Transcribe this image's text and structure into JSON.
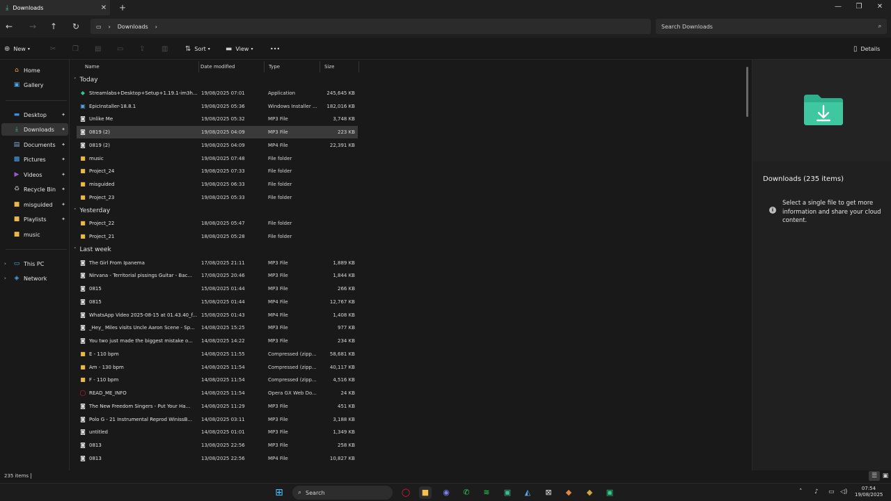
{
  "window": {
    "tab_title": "Downloads",
    "new_tab": "+",
    "close_tab": "✕"
  },
  "address": {
    "breadcrumb": [
      "Downloads"
    ],
    "search_placeholder": "Search Downloads"
  },
  "commands": {
    "new": "New",
    "sort": "Sort",
    "view": "View",
    "more": "•••",
    "details": "Details"
  },
  "sidebar": {
    "items": [
      {
        "label": "Home",
        "icon": "home-icon",
        "glyph": "⌂",
        "color": "#e6a23c",
        "pinned": false
      },
      {
        "label": "Gallery",
        "icon": "gallery-icon",
        "glyph": "▣",
        "color": "#4fa3e0",
        "pinned": false
      },
      {
        "label": "Desktop",
        "icon": "desktop-icon",
        "glyph": "▬",
        "color": "#3d8ee0",
        "pinned": true
      },
      {
        "label": "Downloads",
        "icon": "download-icon",
        "glyph": "⤓",
        "color": "#3fb8a4",
        "pinned": true,
        "selected": true
      },
      {
        "label": "Documents",
        "icon": "document-icon",
        "glyph": "▤",
        "color": "#7fa7d8",
        "pinned": true
      },
      {
        "label": "Pictures",
        "icon": "picture-icon",
        "glyph": "▩",
        "color": "#4aa0e6",
        "pinned": true
      },
      {
        "label": "Videos",
        "icon": "video-icon",
        "glyph": "▶",
        "color": "#9b59d0",
        "pinned": true
      },
      {
        "label": "Recycle Bin",
        "icon": "recycle-bin-icon",
        "glyph": "♻",
        "color": "#9aa5b1",
        "pinned": true
      },
      {
        "label": "misguided",
        "icon": "folder-icon",
        "glyph": "■",
        "color": "#e8b94a",
        "pinned": true
      },
      {
        "label": "Playlists",
        "icon": "folder-icon",
        "glyph": "■",
        "color": "#e8b94a",
        "pinned": true
      },
      {
        "label": "music",
        "icon": "folder-icon",
        "glyph": "■",
        "color": "#e8b94a",
        "pinned": false
      }
    ],
    "tree": [
      {
        "label": "This PC",
        "icon": "computer-icon",
        "glyph": "▭",
        "color": "#4fb0e0"
      },
      {
        "label": "Network",
        "icon": "network-icon",
        "glyph": "◈",
        "color": "#4f9fe0"
      }
    ]
  },
  "columns": {
    "name": "Name",
    "date": "Date modified",
    "type": "Type",
    "size": "Size"
  },
  "groups": [
    {
      "label": "Today",
      "rows": [
        {
          "name": "Streamlabs+Desktop+Setup+1.19.1-im3h...",
          "date": "19/08/2025 07:01",
          "type": "Application",
          "size": "245,645 KB",
          "icon": "app-icon",
          "glyph": "◆",
          "color": "#31c48d"
        },
        {
          "name": "EpicInstaller-18.8.1",
          "date": "19/08/2025 05:36",
          "type": "Windows Installer ...",
          "size": "182,016 KB",
          "icon": "installer-icon",
          "glyph": "▣",
          "color": "#5aa0e0"
        },
        {
          "name": "Unlike Me",
          "date": "19/08/2025 05:32",
          "type": "MP3 File",
          "size": "3,748 KB",
          "icon": "audio-file-icon",
          "glyph": "◙",
          "color": "#dcdcdc"
        },
        {
          "name": "0819 (2)",
          "date": "19/08/2025 04:09",
          "type": "MP3 File",
          "size": "223 KB",
          "icon": "audio-file-icon",
          "glyph": "◙",
          "color": "#dcdcdc",
          "selected": true
        },
        {
          "name": "0819 (2)",
          "date": "19/08/2025 04:09",
          "type": "MP4 File",
          "size": "22,391 KB",
          "icon": "video-file-icon",
          "glyph": "◙",
          "color": "#dcdcdc"
        },
        {
          "name": "music",
          "date": "19/08/2025 07:48",
          "type": "File folder",
          "size": "",
          "icon": "folder-icon",
          "glyph": "■",
          "color": "#e8b94a"
        },
        {
          "name": "Project_24",
          "date": "19/08/2025 07:33",
          "type": "File folder",
          "size": "",
          "icon": "folder-icon",
          "glyph": "■",
          "color": "#e8b94a"
        },
        {
          "name": "misguided",
          "date": "19/08/2025 06:33",
          "type": "File folder",
          "size": "",
          "icon": "folder-icon",
          "glyph": "■",
          "color": "#e8b94a"
        },
        {
          "name": "Project_23",
          "date": "19/08/2025 05:33",
          "type": "File folder",
          "size": "",
          "icon": "folder-icon",
          "glyph": "■",
          "color": "#e8b94a"
        }
      ]
    },
    {
      "label": "Yesterday",
      "rows": [
        {
          "name": "Project_22",
          "date": "18/08/2025 05:47",
          "type": "File folder",
          "size": "",
          "icon": "folder-icon",
          "glyph": "■",
          "color": "#e8b94a"
        },
        {
          "name": "Project_21",
          "date": "18/08/2025 05:28",
          "type": "File folder",
          "size": "",
          "icon": "folder-icon",
          "glyph": "■",
          "color": "#e8b94a"
        }
      ]
    },
    {
      "label": "Last week",
      "rows": [
        {
          "name": "The Girl From Ipanema",
          "date": "17/08/2025 21:11",
          "type": "MP3 File",
          "size": "1,889 KB",
          "icon": "audio-file-icon",
          "glyph": "◙",
          "color": "#dcdcdc"
        },
        {
          "name": "Nirvana - Territorial pissings Guitar - Bac...",
          "date": "17/08/2025 20:46",
          "type": "MP3 File",
          "size": "1,844 KB",
          "icon": "audio-file-icon",
          "glyph": "◙",
          "color": "#dcdcdc"
        },
        {
          "name": "0815",
          "date": "15/08/2025 01:44",
          "type": "MP3 File",
          "size": "266 KB",
          "icon": "audio-file-icon",
          "glyph": "◙",
          "color": "#dcdcdc"
        },
        {
          "name": "0815",
          "date": "15/08/2025 01:44",
          "type": "MP4 File",
          "size": "12,767 KB",
          "icon": "video-file-icon",
          "glyph": "◙",
          "color": "#dcdcdc"
        },
        {
          "name": "WhatsApp Video 2025-08-15 at 01.43.40_f...",
          "date": "15/08/2025 01:43",
          "type": "MP4 File",
          "size": "1,408 KB",
          "icon": "video-file-icon",
          "glyph": "◙",
          "color": "#dcdcdc"
        },
        {
          "name": "_Hey_ Miles visits Uncle Aaron Scene - Sp...",
          "date": "14/08/2025 15:25",
          "type": "MP3 File",
          "size": "977 KB",
          "icon": "audio-file-icon",
          "glyph": "◙",
          "color": "#dcdcdc"
        },
        {
          "name": "You two just made the biggest mistake o...",
          "date": "14/08/2025 14:22",
          "type": "MP3 File",
          "size": "234 KB",
          "icon": "audio-file-icon",
          "glyph": "◙",
          "color": "#dcdcdc"
        },
        {
          "name": "E - 110 bpm",
          "date": "14/08/2025 11:55",
          "type": "Compressed (zipp...",
          "size": "58,681 KB",
          "icon": "zip-folder-icon",
          "glyph": "■",
          "color": "#e8b94a"
        },
        {
          "name": "Am - 130 bpm",
          "date": "14/08/2025 11:54",
          "type": "Compressed (zipp...",
          "size": "40,117 KB",
          "icon": "zip-folder-icon",
          "glyph": "■",
          "color": "#e8b94a"
        },
        {
          "name": "F - 110 bpm",
          "date": "14/08/2025 11:54",
          "type": "Compressed (zipp...",
          "size": "4,516 KB",
          "icon": "zip-folder-icon",
          "glyph": "■",
          "color": "#e8b94a"
        },
        {
          "name": "READ_ME_INFO",
          "date": "14/08/2025 11:54",
          "type": "Opera GX Web Do...",
          "size": "24 KB",
          "icon": "opera-gx-icon",
          "glyph": "◯",
          "color": "#e0233f"
        },
        {
          "name": "The New Freedom Singers - Put Your Ha...",
          "date": "14/08/2025 11:29",
          "type": "MP3 File",
          "size": "451 KB",
          "icon": "audio-file-icon",
          "glyph": "◙",
          "color": "#dcdcdc"
        },
        {
          "name": "Polo G - 21 Instrumental Reprod WinissB...",
          "date": "14/08/2025 03:11",
          "type": "MP3 File",
          "size": "3,188 KB",
          "icon": "audio-file-icon",
          "glyph": "◙",
          "color": "#dcdcdc"
        },
        {
          "name": "untitled",
          "date": "14/08/2025 01:01",
          "type": "MP3 File",
          "size": "1,349 KB",
          "icon": "audio-file-icon",
          "glyph": "◙",
          "color": "#dcdcdc"
        },
        {
          "name": "0813",
          "date": "13/08/2025 22:56",
          "type": "MP3 File",
          "size": "258 KB",
          "icon": "audio-file-icon",
          "glyph": "◙",
          "color": "#dcdcdc"
        },
        {
          "name": "0813",
          "date": "13/08/2025 22:56",
          "type": "MP4 File",
          "size": "10,827 KB",
          "icon": "video-file-icon",
          "glyph": "◙",
          "color": "#dcdcdc"
        }
      ]
    }
  ],
  "details": {
    "title": "Downloads (235 items)",
    "info": "Select a single file to get more information and share your cloud content.",
    "folder_color": "#3fc7a0"
  },
  "status": {
    "count": "235 items"
  },
  "taskbar": {
    "search_label": "Search",
    "clock_time": "07:54",
    "clock_date": "19/08/2025",
    "apps": [
      {
        "name": "start-icon",
        "glyph": "⊞",
        "color": "#4cc2ff"
      },
      {
        "name": "opera-gx-icon",
        "glyph": "◯",
        "color": "#e0233f"
      },
      {
        "name": "file-explorer-icon",
        "glyph": "■",
        "color": "#f2c14e"
      },
      {
        "name": "discord-icon",
        "glyph": "◉",
        "color": "#7b7ff0"
      },
      {
        "name": "whatsapp-icon",
        "glyph": "✆",
        "color": "#2ad466"
      },
      {
        "name": "spotify-icon",
        "glyph": "≋",
        "color": "#1ed760"
      },
      {
        "name": "app-icon",
        "glyph": "▣",
        "color": "#3dbf8e"
      },
      {
        "name": "app-icon",
        "glyph": "◭",
        "color": "#5fa8e8"
      },
      {
        "name": "app-icon",
        "glyph": "⊠",
        "color": "#e0e0e0"
      },
      {
        "name": "app-icon",
        "glyph": "◆",
        "color": "#e0883d"
      },
      {
        "name": "app-icon",
        "glyph": "◆",
        "color": "#d0a53d"
      },
      {
        "name": "app-icon",
        "glyph": "▣",
        "color": "#2ecf8b"
      }
    ]
  }
}
